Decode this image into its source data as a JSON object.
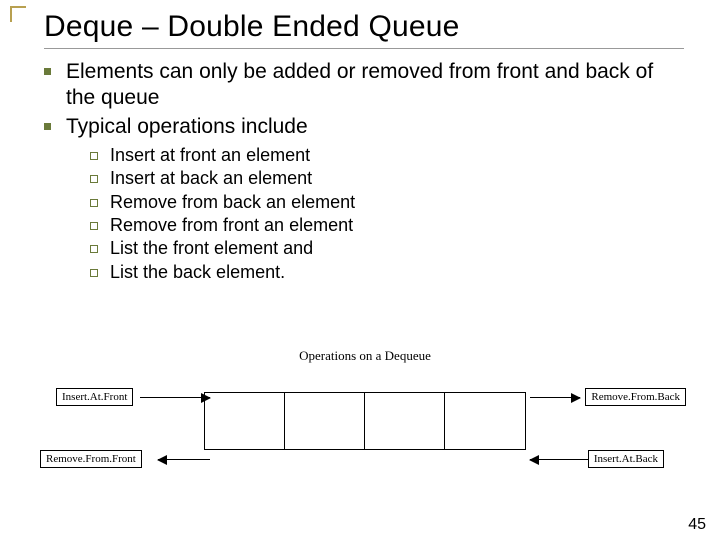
{
  "title": "Deque – Double Ended Queue",
  "bullets": [
    "Elements can only be added or removed from front and back of the queue",
    "Typical operations include"
  ],
  "sublist": [
    "Insert at front an element",
    "Insert at back an element",
    "Remove from back an element",
    "Remove from front an element",
    "List the front element and",
    "List the back element."
  ],
  "diagram": {
    "title": "Operations on a Dequeue",
    "labels": {
      "insert_front": "Insert.At.Front",
      "remove_front": "Remove.From.Front",
      "remove_back": "Remove.From.Back",
      "insert_back": "Insert.At.Back"
    }
  },
  "page_number": "45"
}
